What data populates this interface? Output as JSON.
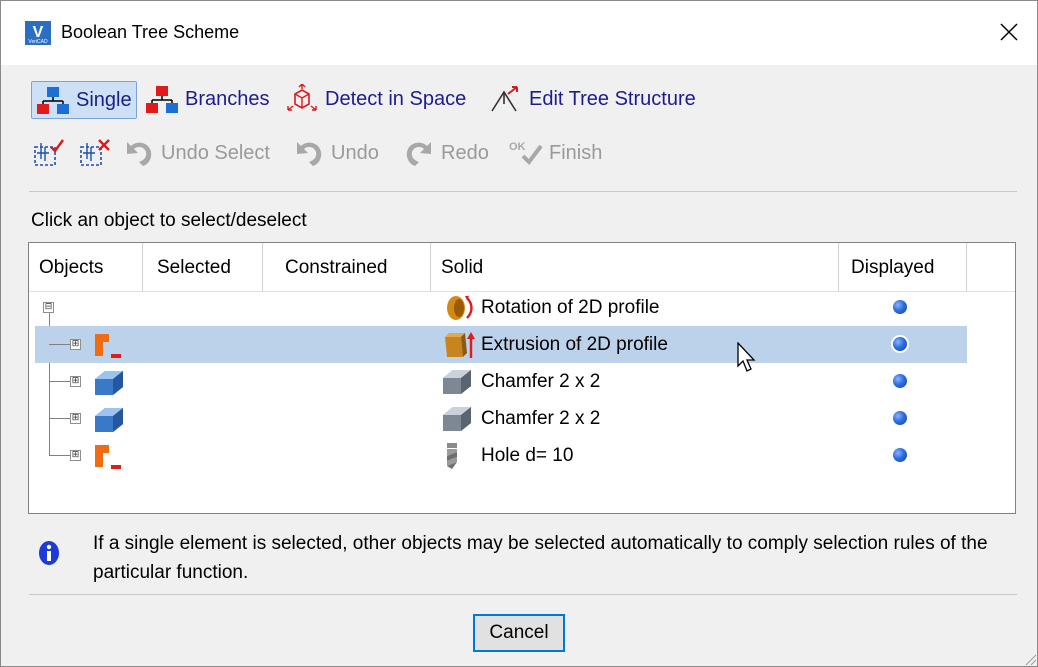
{
  "window": {
    "title": "Boolean Tree Scheme",
    "app_icon_letter": "V",
    "app_icon_sub": "VeriCAD"
  },
  "toolbar_row1": [
    {
      "label": "Single",
      "icon": "single-selection-icon",
      "active": true
    },
    {
      "label": "Branches",
      "icon": "branches-icon"
    },
    {
      "label": "Detect in Space",
      "icon": "detect-in-space-icon"
    },
    {
      "label": "Edit Tree Structure",
      "icon": "edit-tree-structure-icon"
    }
  ],
  "toolbar_row2": [
    {
      "label": "",
      "icon": "select-all-icon"
    },
    {
      "label": "",
      "icon": "deselect-all-icon"
    },
    {
      "label": "Undo Select",
      "icon": "undo-select-icon",
      "disabled": true
    },
    {
      "label": "Undo",
      "icon": "undo-icon",
      "disabled": true
    },
    {
      "label": "Redo",
      "icon": "redo-icon",
      "disabled": true
    },
    {
      "label": "Finish",
      "icon": "finish-ok-icon",
      "disabled": true
    }
  ],
  "hint": "Click an object to select/deselect",
  "columns": [
    "Objects",
    "Selected",
    "Constrained",
    "Solid",
    "Displayed"
  ],
  "rows": [
    {
      "solid": "Rotation of 2D profile",
      "solid_icon": "rotation-icon",
      "object_icon": "",
      "expander": "⊟",
      "displayed": true
    },
    {
      "solid": "Extrusion of 2D profile",
      "solid_icon": "extrusion-icon",
      "object_icon": "profile-icon",
      "expander": "⊞",
      "displayed": true,
      "highlighted": true
    },
    {
      "solid": "Chamfer 2 x 2",
      "solid_icon": "chamfer-icon",
      "object_icon": "chamfer-solid-icon",
      "expander": "⊞",
      "displayed": true
    },
    {
      "solid": "Chamfer 2 x 2",
      "solid_icon": "chamfer-icon",
      "object_icon": "chamfer-solid-icon",
      "expander": "⊞",
      "displayed": true
    },
    {
      "solid": "Hole d= 10",
      "solid_icon": "drill-hole-icon",
      "object_icon": "profile-icon",
      "expander": "⊞",
      "displayed": true
    }
  ],
  "info": "If a single element is selected, other objects may be selected automatically to comply selection rules of the particular function.",
  "cancel_label": "Cancel",
  "colors": {
    "link_blue": "#1c1c8c",
    "selection_row": "#bcd2ea",
    "focus_border": "#0078d7",
    "disabled_text": "#9a9a9a"
  }
}
